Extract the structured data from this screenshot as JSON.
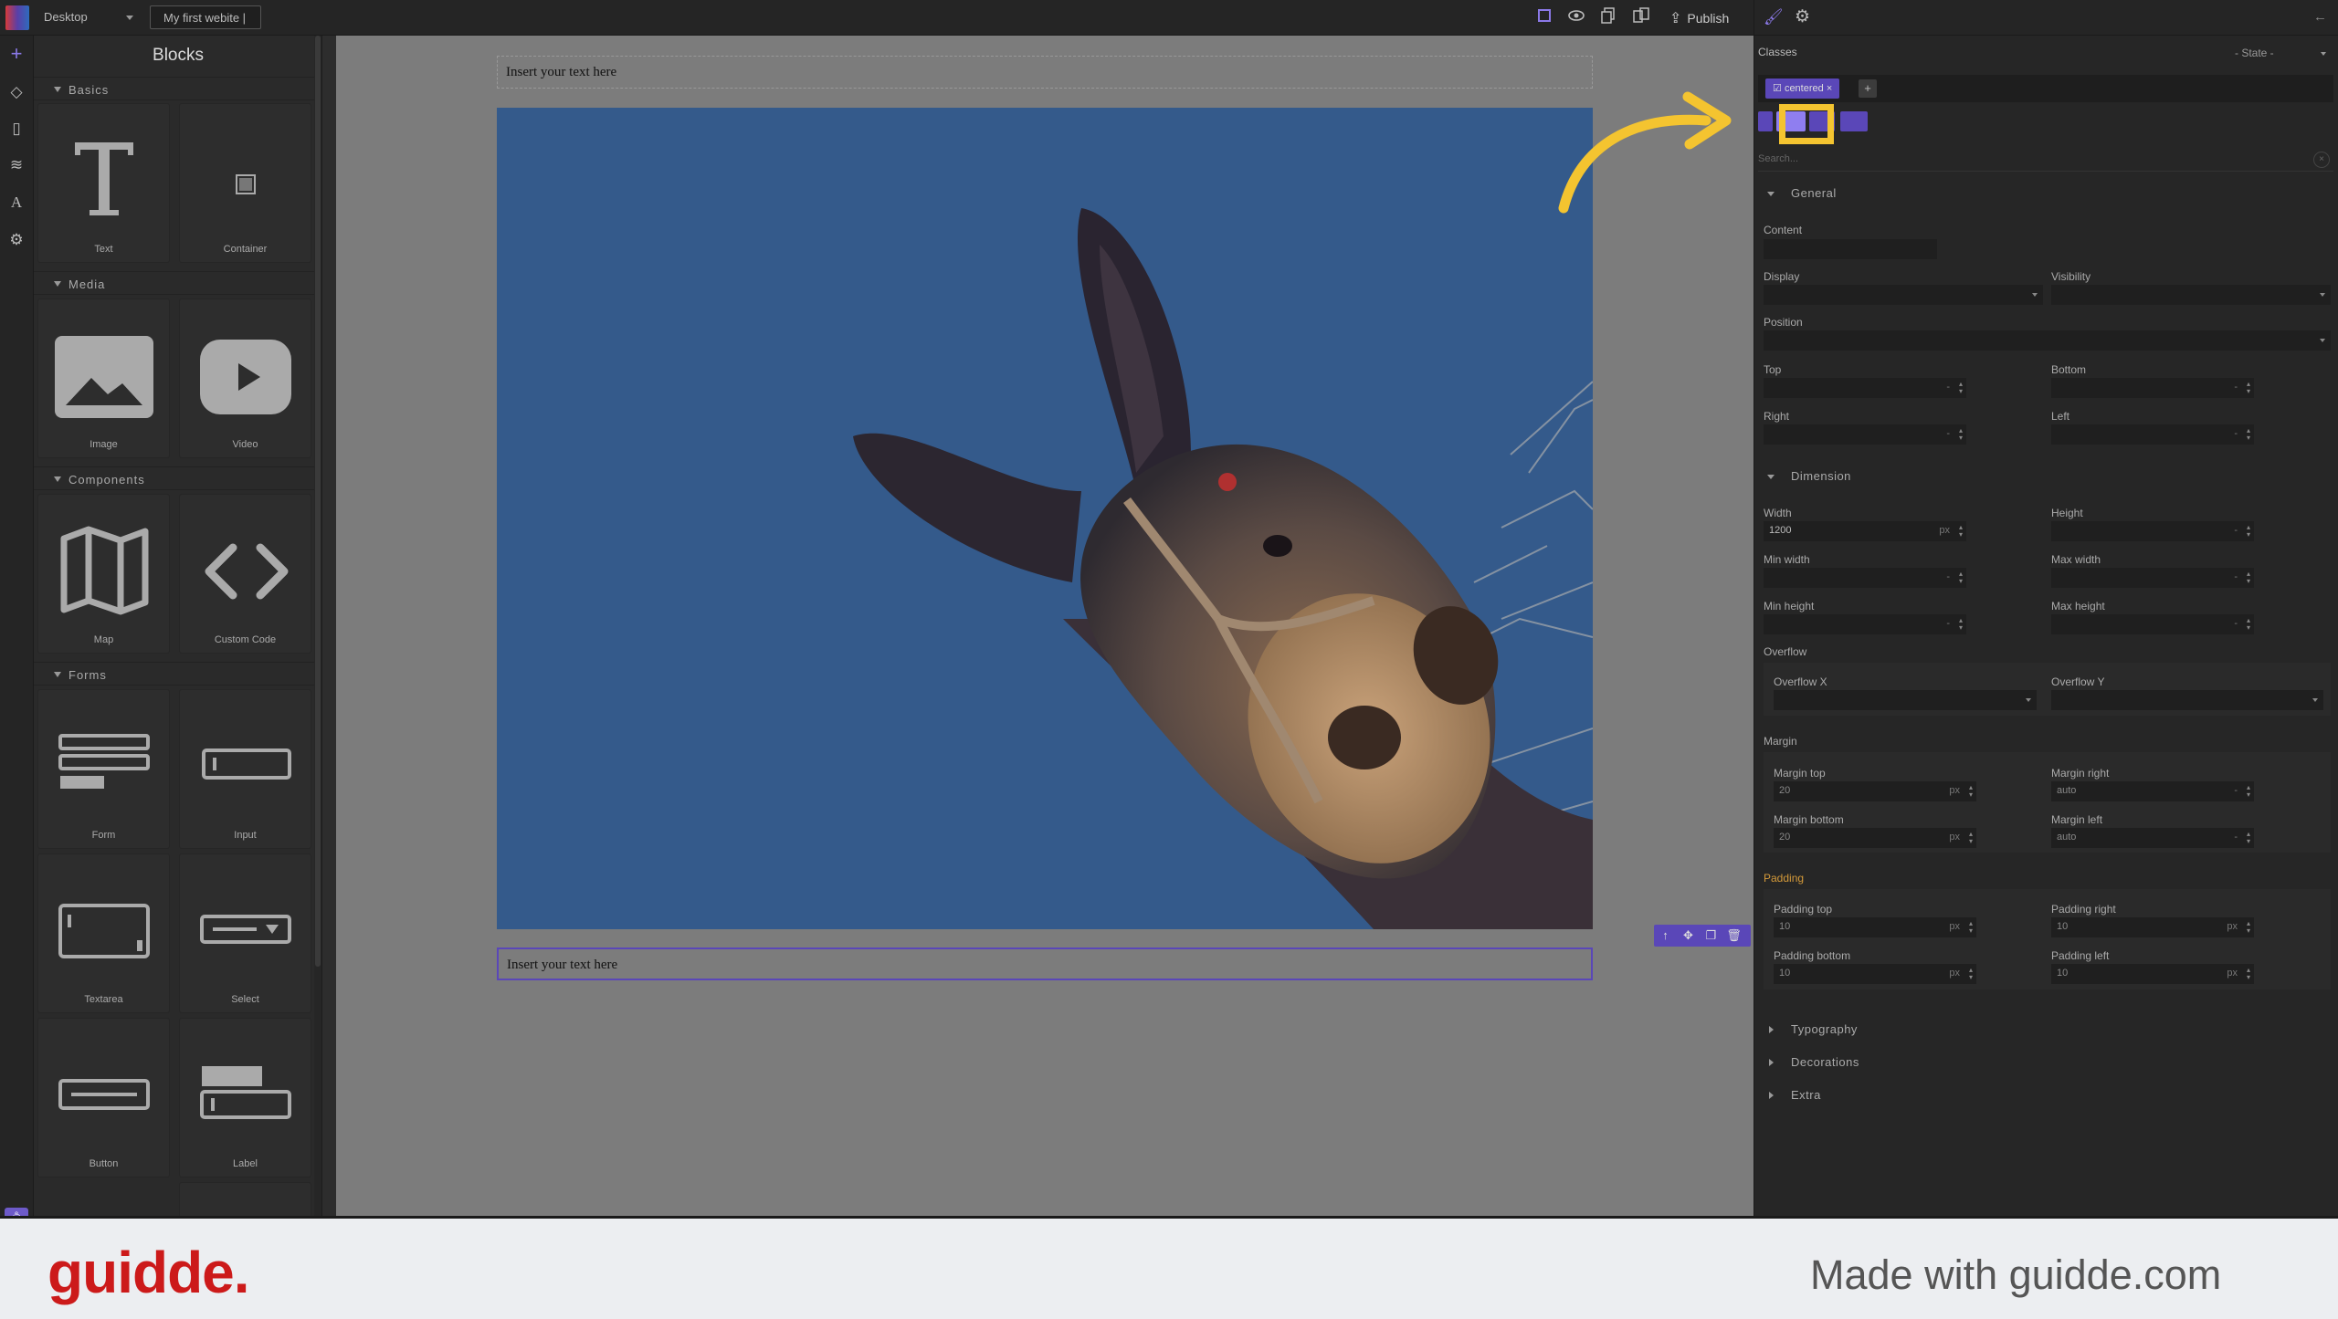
{
  "topbar": {
    "device": "Desktop",
    "site_name": "My first webite |",
    "publish_label": "Publish",
    "icons": [
      "square-outline-icon",
      "eye-icon",
      "copy-icon",
      "import-icon",
      "upload-icon"
    ]
  },
  "rail": {
    "icons": [
      "plus-icon",
      "diamond-icon",
      "page-icon",
      "layers-icon",
      "typography-icon",
      "settings-icon"
    ],
    "bell": "bell-icon"
  },
  "blocks": {
    "title": "Blocks",
    "categories": [
      {
        "label": "Basics",
        "items": [
          "Text",
          "Container"
        ]
      },
      {
        "label": "Media",
        "items": [
          "Image",
          "Video"
        ]
      },
      {
        "label": "Components",
        "items": [
          "Map",
          "Custom Code"
        ]
      },
      {
        "label": "Forms",
        "items": [
          "Form",
          "Input",
          "Textarea",
          "Select",
          "Button",
          "Label"
        ]
      }
    ]
  },
  "canvas": {
    "text_top": "Insert your text here",
    "text_bottom": "Insert your text here",
    "toolbar_icons": [
      "arrow-up-icon",
      "move-icon",
      "clone-icon",
      "trash-icon"
    ]
  },
  "style_manager": {
    "classes_label": "Classes",
    "state_label": "- State -",
    "class_tag": "centered",
    "add_label": "+",
    "search_placeholder": "Search...",
    "sections": {
      "general": "General",
      "dimension": "Dimension",
      "typography": "Typography",
      "decorations": "Decorations",
      "extra": "Extra"
    },
    "props": {
      "content": "Content",
      "display": "Display",
      "visibility": "Visibility",
      "position": "Position",
      "top": "Top",
      "bottom": "Bottom",
      "right": "Right",
      "left": "Left",
      "width": "Width",
      "width_value": "1200",
      "width_unit": "px",
      "height": "Height",
      "min_width": "Min width",
      "max_width": "Max width",
      "min_height": "Min height",
      "max_height": "Max height",
      "overflow": "Overflow",
      "overflow_x": "Overflow X",
      "overflow_y": "Overflow Y",
      "margin": "Margin",
      "margin_top": "Margin top",
      "margin_top_value": "20",
      "margin_right": "Margin right",
      "margin_right_value": "auto",
      "margin_bottom": "Margin bottom",
      "margin_bottom_value": "20",
      "margin_left": "Margin left",
      "margin_left_value": "auto",
      "padding": "Padding",
      "padding_top": "Padding top",
      "padding_top_value": "10",
      "padding_right": "Padding right",
      "padding_right_value": "10",
      "padding_bottom": "Padding bottom",
      "padding_bottom_value": "10",
      "padding_left": "Padding left",
      "padding_left_value": "10",
      "unit_px": "px",
      "dash": "-"
    }
  },
  "footer": {
    "brand": "guidde.",
    "made_with": "Made with guidde.com"
  },
  "colors": {
    "accent": "#5a47b8",
    "highlight": "#f4c430",
    "brand": "#cc1a1a"
  }
}
